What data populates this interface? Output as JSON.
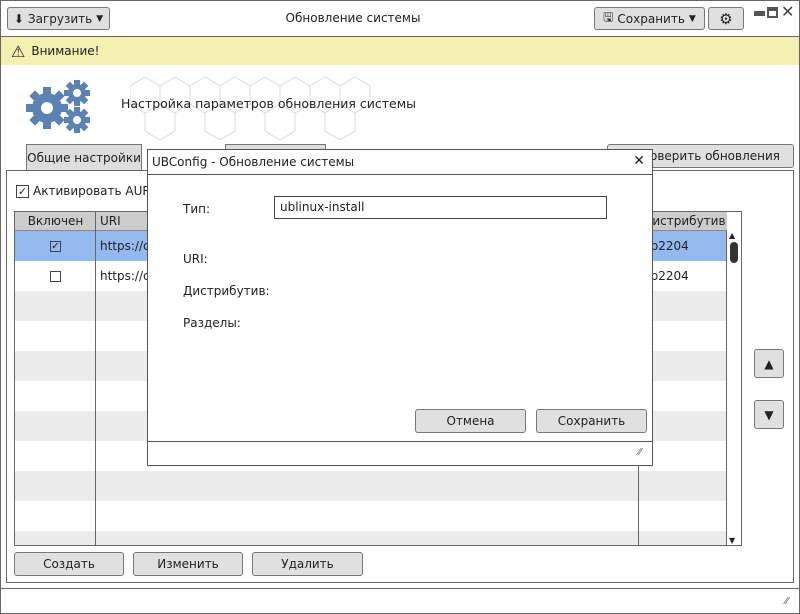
{
  "toolbar": {
    "load_label": "Загрузить",
    "title": "Обновление системы",
    "save_label": "Сохранить"
  },
  "warning": {
    "text": "Внимание!",
    "color": "#f3f0b0"
  },
  "header": {
    "title": "Настройка параметров обновления системы",
    "accent": "#5b82b3"
  },
  "tabs": [
    {
      "label": "Общие настройки"
    },
    {
      "label": ""
    }
  ],
  "check_updates_label": "Проверить обновления",
  "aur": {
    "label": "Активировать AUR",
    "checked": true
  },
  "table": {
    "columns": [
      "Включен",
      "URI",
      "Дистрибутив"
    ],
    "rows": [
      {
        "enabled": true,
        "uri": "https://c",
        "dist": "db2204",
        "selected": true
      },
      {
        "enabled": false,
        "uri": "https://c",
        "dist": "db2204",
        "selected": false
      }
    ],
    "selected_color": "#93b9ee"
  },
  "buttons": {
    "create": "Создать",
    "edit": "Изменить",
    "delete": "Удалить"
  },
  "dialog": {
    "title": "UBConfig - Обновление системы",
    "type_label": "Тип:",
    "type_value": "ublinux-install",
    "uri_label": "URI:",
    "dist_label": "Дистрибутив:",
    "sections_label": "Разделы:",
    "cancel": "Отмена",
    "save": "Сохранить"
  }
}
